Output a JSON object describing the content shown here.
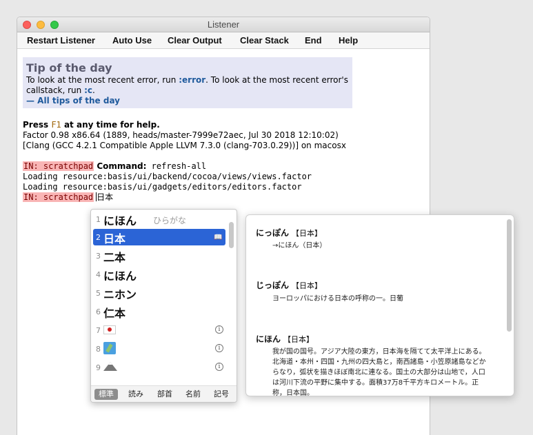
{
  "window": {
    "title": "Listener"
  },
  "toolbar": {
    "restart": "Restart Listener",
    "auto_use": "Auto Use",
    "clear_output": "Clear Output",
    "clear_stack": "Clear Stack",
    "end": "End",
    "help": "Help"
  },
  "tip": {
    "title": "Tip of the day",
    "line1_a": "To look at the most recent error, run ",
    "line1_kw": ":error",
    "line1_b": ". To look at the most recent error's",
    "line2_a": "callstack, run ",
    "line2_kw": ":c",
    "line2_b": ".",
    "link": "— All tips of the day"
  },
  "output": {
    "press": "Press ",
    "f1": "F1",
    "help_text": " at any time for help.",
    "version": "Factor 0.98 x86.64 (1889, heads/master-7999e72aec, Jul 30 2018 12:10:02)",
    "compiler": "[Clang (GCC 4.2.1 Compatible Apple LLVM 7.3.0 (clang-703.0.29))] on macosx",
    "prompt": "IN: scratchpad",
    "command_label": " Command:",
    "command": " refresh-all",
    "load1": "Loading resource:basis/ui/backend/cocoa/views/views.factor",
    "load2": "Loading resource:basis/ui/gadgets/editors/editors.factor",
    "prompt2": "IN: scratchpad",
    "input": "日本"
  },
  "candidates": {
    "items": [
      {
        "num": "1",
        "text": "にほん",
        "hint": "ひらがな"
      },
      {
        "num": "2",
        "text": "日本"
      },
      {
        "num": "3",
        "text": "二本"
      },
      {
        "num": "4",
        "text": "にほん"
      },
      {
        "num": "5",
        "text": "ニホン"
      },
      {
        "num": "6",
        "text": "仁本"
      },
      {
        "num": "7"
      },
      {
        "num": "8"
      },
      {
        "num": "9"
      }
    ],
    "tabs": [
      "標準",
      "読み",
      "部首",
      "名前",
      "記号"
    ],
    "info_glyph": "i"
  },
  "dictionary": {
    "entries": [
      {
        "reading": "にっぽん",
        "kanji": "【日本】",
        "body": "→にほん（日本）"
      },
      {
        "reading": "じっぽん",
        "kanji": "【日本】",
        "body": "ヨーロッパにおける日本の呼称の一。日葡"
      },
      {
        "reading": "にほん",
        "kanji": "【日本】",
        "body": "我が国の国号。アジア大陸の東方，日本海を隔てて太平洋上にある。北海道・本州・四国・九州の四大島と，南西諸島・小笠原諸島などからなり，弧状を描きほぼ南北に連なる。国土の大部分は山地で，人口は河川下流の平野に集中する。面積37万8千平方キロメートル。正称，日本国。"
      }
    ]
  },
  "icons": {
    "close": "close-icon",
    "minimize": "minimize-icon",
    "maximize": "maximize-icon",
    "book": "book-icon",
    "info": "info-icon"
  }
}
